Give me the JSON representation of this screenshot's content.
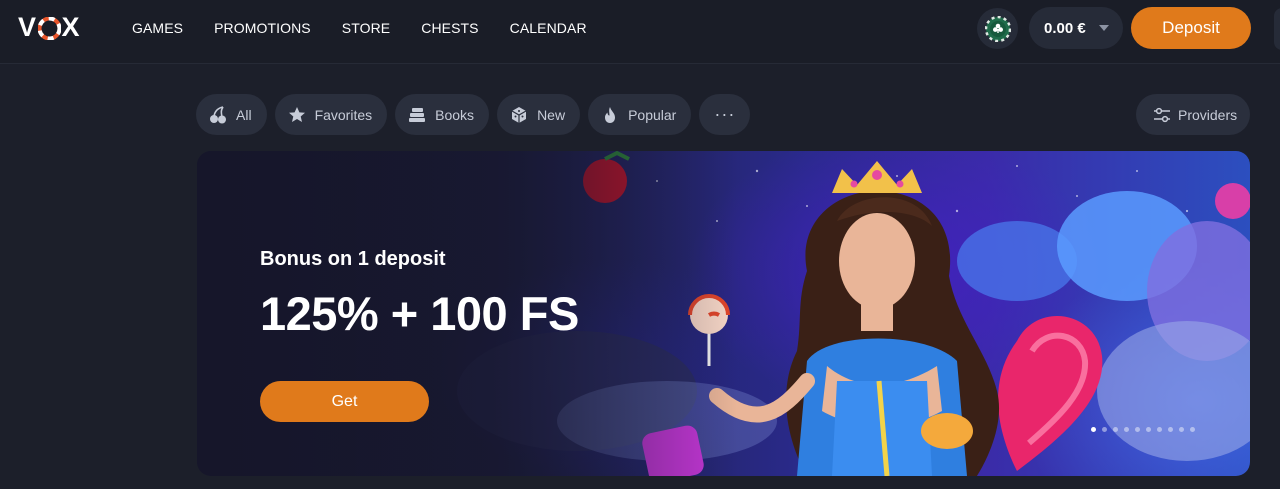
{
  "header": {
    "logo_text": "VOX",
    "nav": [
      "GAMES",
      "PROMOTIONS",
      "STORE",
      "CHESTS",
      "CALENDAR"
    ],
    "balance": "0.00 €",
    "deposit_label": "Deposit",
    "club_icon": "club-chip-icon"
  },
  "filters": {
    "chips": [
      {
        "label": "All",
        "icon": "cherries-icon"
      },
      {
        "label": "Favorites",
        "icon": "star-icon"
      },
      {
        "label": "Books",
        "icon": "books-icon"
      },
      {
        "label": "New",
        "icon": "dice-icon"
      },
      {
        "label": "Popular",
        "icon": "flame-icon"
      }
    ],
    "more_label": "···",
    "providers_label": "Providers",
    "providers_icon": "sliders-icon"
  },
  "banner": {
    "subtitle": "Bonus on 1 deposit",
    "headline": "125% + 100 FS",
    "cta_label": "Get",
    "slide_count": 10,
    "active_slide": 1
  },
  "colors": {
    "accent": "#e07a1b",
    "background": "#1c1f2a",
    "chip_bg": "#2a2f3d"
  }
}
